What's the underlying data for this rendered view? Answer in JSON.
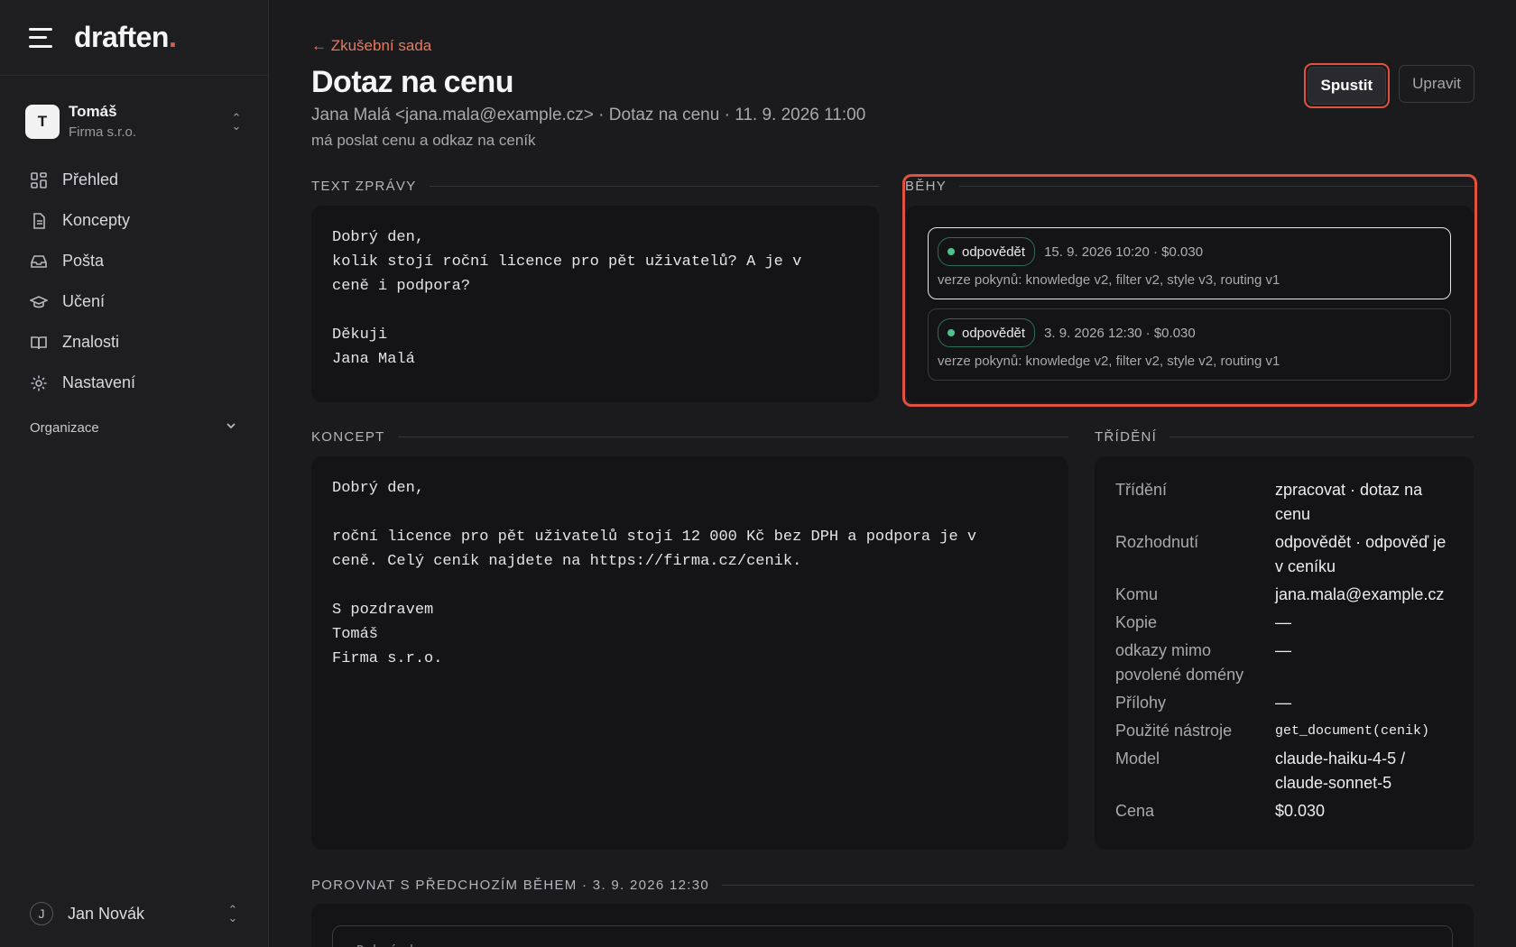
{
  "app": {
    "logo_text": "draften",
    "logo_dot": "."
  },
  "org": {
    "avatar": "T",
    "name": "Tomáš",
    "company": "Firma s.r.o."
  },
  "nav": {
    "items": [
      {
        "label": "Přehled",
        "icon": "grid-icon"
      },
      {
        "label": "Koncepty",
        "icon": "document-icon"
      },
      {
        "label": "Pošta",
        "icon": "inbox-icon"
      },
      {
        "label": "Učení",
        "icon": "graduation-cap-icon"
      },
      {
        "label": "Znalosti",
        "icon": "book-icon"
      },
      {
        "label": "Nastavení",
        "icon": "gear-icon"
      }
    ],
    "section": "Organizace"
  },
  "user": {
    "avatar": "J",
    "name": "Jan Novák"
  },
  "page": {
    "back": "← Zkušební sada",
    "title": "Dotaz na cenu",
    "meta": "Jana Malá <jana.mala@example.cz> · Dotaz na cenu · 11. 9. 2026 11:00",
    "note": "má poslat cenu a odkaz na ceník",
    "run_button": "Spustit",
    "edit_button": "Upravit"
  },
  "message": {
    "label": "TEXT ZPRÁVY",
    "body": "Dobrý den,\nkolik stojí roční licence pro pět uživatelů? A je v\nceně i podpora?\n\nDěkuji\nJana Malá"
  },
  "runs": {
    "label": "BĚHY",
    "items": [
      {
        "badge": "odpovědět",
        "date": "15. 9. 2026 10:20 · $0.030",
        "versions": "verze pokynů: knowledge v2, filter v2, style v3, routing v1"
      },
      {
        "badge": "odpovědět",
        "date": "3. 9. 2026 12:30 · $0.030",
        "versions": "verze pokynů: knowledge v2, filter v2, style v2, routing v1"
      }
    ]
  },
  "draft": {
    "label": "KONCEPT",
    "body": "Dobrý den,\n\nroční licence pro pět uživatelů stojí 12 000 Kč bez DPH a podpora je v\nceně. Celý ceník najdete na https://firma.cz/cenik.\n\nS pozdravem\nTomáš\nFirma s.r.o."
  },
  "triage": {
    "label": "TŘÍDĚNÍ",
    "rows": [
      {
        "k": "Třídění",
        "v": "zpracovat · dotaz na cenu"
      },
      {
        "k": "Rozhodnutí",
        "v": "odpovědět · odpověď je v ceníku"
      },
      {
        "k": "Komu",
        "v": "jana.mala@example.cz"
      },
      {
        "k": "Kopie",
        "v": "—"
      },
      {
        "k": "odkazy mimo povolené domény",
        "v": "—"
      },
      {
        "k": "Přílohy",
        "v": "—"
      },
      {
        "k": "Použité nástroje",
        "v": "get_document(cenik)"
      },
      {
        "k": "Model",
        "v": "claude-haiku-4-5 / claude-sonnet-5"
      },
      {
        "k": "Cena",
        "v": "$0.030"
      }
    ]
  },
  "compare": {
    "label": "POROVNAT S PŘEDCHOZÍM BĚHEM · 3. 9. 2026 12:30",
    "preview": "Dobrý den,"
  },
  "colors": {
    "accent": "#e05a45",
    "link": "#e8795f",
    "status_green": "#4cc38a",
    "background": "#1b1b1e"
  }
}
